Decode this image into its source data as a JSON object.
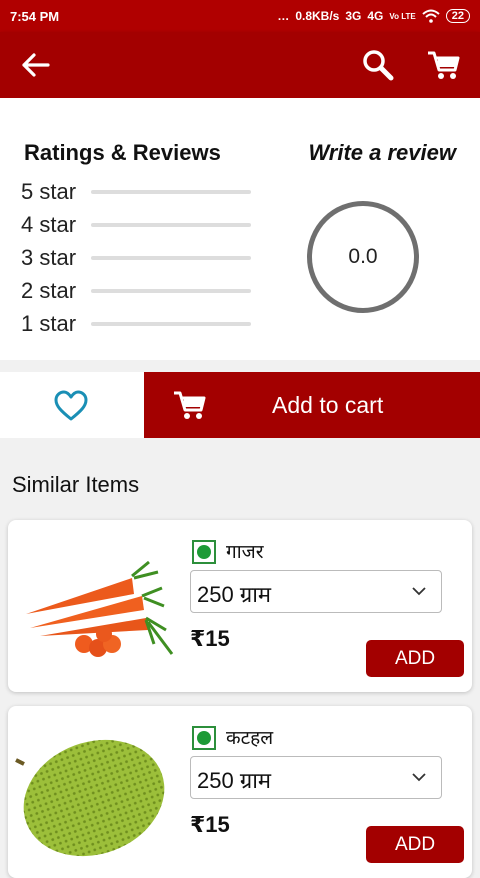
{
  "status": {
    "time": "7:54 PM",
    "net": "0.8KB/s",
    "signal1": "3G",
    "signal2": "4G",
    "volte": "Vo LTE",
    "battery": "22"
  },
  "toolbar": {
    "back_icon": "back-arrow-icon",
    "search_icon": "search-icon",
    "cart_icon": "cart-icon"
  },
  "ratings": {
    "title": "Ratings & Reviews",
    "write_review": "Write a review",
    "rows": [
      {
        "label": "5 star",
        "fraction": 0
      },
      {
        "label": "4 star",
        "fraction": 0
      },
      {
        "label": "3 star",
        "fraction": 0
      },
      {
        "label": "2 star",
        "fraction": 0
      },
      {
        "label": "1 star",
        "fraction": 0
      }
    ],
    "average": "0.0"
  },
  "actions": {
    "favorite_icon": "heart-icon",
    "add_to_cart": "Add to cart"
  },
  "similar": {
    "title": "Similar Items",
    "items": [
      {
        "name": "गाजर",
        "quantity": "250 ग्राम",
        "price": "₹15",
        "add": "ADD",
        "image": "carrot-image"
      },
      {
        "name": "कटहल",
        "quantity": "250 ग्राम",
        "price": "₹15",
        "add": "ADD",
        "image": "jackfruit-image"
      }
    ]
  },
  "colors": {
    "brand": "#a30000",
    "veg": "#1d9a36"
  }
}
